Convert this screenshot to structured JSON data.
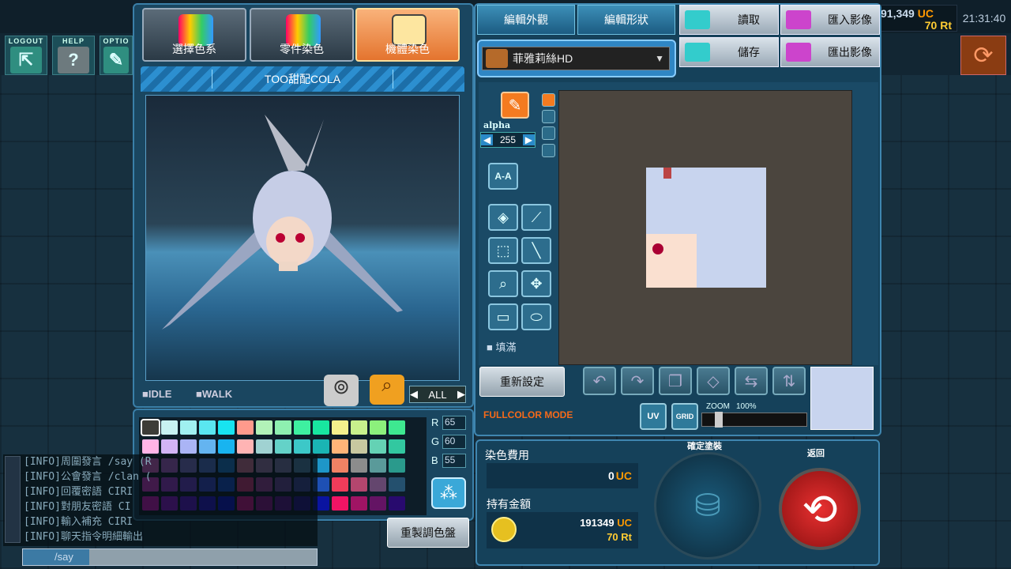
{
  "topbar": {
    "logout": "LOGOUT",
    "help": "HELP",
    "option": "OPTIO",
    "uc": "91,349",
    "uc_unit": "UC",
    "rt": "70",
    "rt_unit": "Rt",
    "clock": "21:31:40"
  },
  "tabs": [
    {
      "label": "選擇色系"
    },
    {
      "label": "零件染色"
    },
    {
      "label": "機體染色"
    }
  ],
  "preview": {
    "title": "TOO甜配COLA",
    "idle": "IDLE",
    "walk": "WALK",
    "filter": "ALL"
  },
  "rgb": {
    "r_label": "R",
    "r": "65",
    "g_label": "G",
    "g": "60",
    "b_label": "B",
    "b": "55"
  },
  "palette": {
    "rows": [
      [
        "#3d3c37",
        "#c8f2f2",
        "#a0f0f0",
        "#5ae6f0",
        "#18e4f0",
        "#ff9a8c",
        "#b2f2b8",
        "#8ef0b0",
        "#3ef0a0",
        "#18e6a0",
        "#f5f08c",
        "#c8f08c",
        "#8cf07c",
        "#3ee890"
      ],
      [
        "#ffb4e6",
        "#d2b4f5",
        "#aab4f5",
        "#64b4f0",
        "#18b4f0",
        "#ffb4b4",
        "#a0d2d2",
        "#64d2c8",
        "#3cc8c8",
        "#1ab4b4",
        "#ffb478",
        "#c8c8a0",
        "#64d2b4",
        "#32c8a0"
      ],
      [
        "#f56ee6",
        "#c86ef0",
        "#8c82f0",
        "#5a82f0",
        "#1e8cf0",
        "#f082aa",
        "#b48cc8",
        "#8c8cc8",
        "#5a96c8",
        "#1e96c8",
        "#f08264",
        "#8c8c8c",
        "#5a9a9a",
        "#2a9a8c"
      ],
      [
        "#f03ce6",
        "#b43cf0",
        "#7846f0",
        "#3c50f0",
        "#145af0",
        "#f03c8c",
        "#b448b4",
        "#7850b4",
        "#4650b4",
        "#1e50b4",
        "#f03c5a",
        "#b4466e",
        "#64466e",
        "#24506e"
      ],
      [
        "#f014dc",
        "#a014f0",
        "#6414f0",
        "#2814f0",
        "#0a14f0",
        "#f014a0",
        "#a014a0",
        "#6414a0",
        "#2814a0",
        "#0a14a0",
        "#f01464",
        "#a01464",
        "#641464",
        "#280a6e"
      ]
    ],
    "reset": "重製調色盤"
  },
  "chat": {
    "lines": [
      "[INFO]周圍發言 /say (R",
      "[INFO]公會發言 /clan (",
      "[INFO]回覆密語 CIRI",
      "[INFO]對朋友密語 CI",
      "[INFO]輸入補充 CIRI",
      "[INFO]聊天指令明細輸出"
    ],
    "input_placeholder": "/say"
  },
  "editor": {
    "tab_appearance": "編輯外觀",
    "tab_shape": "編輯形狀",
    "load": "讀取",
    "import": "匯入影像",
    "save": "儲存",
    "export": "匯出影像",
    "part": "菲雅莉絲HD",
    "alpha_label": "alpha",
    "alpha": "255",
    "fill": "填滿",
    "reset": "重新設定",
    "mode": "FULLCOLOR MODE",
    "uv": "UV",
    "grid": "GRID",
    "zoom_label": "ZOOM",
    "zoom": "100%",
    "aa": "A-A"
  },
  "cost": {
    "label": "染色費用",
    "value": "0",
    "unit": "UC",
    "own_label": "持有金額",
    "own_uc": "191349",
    "own_uc_unit": "UC",
    "own_rt": "70",
    "own_rt_unit": "Rt",
    "confirm": "確定塗裝",
    "back": "返回"
  }
}
